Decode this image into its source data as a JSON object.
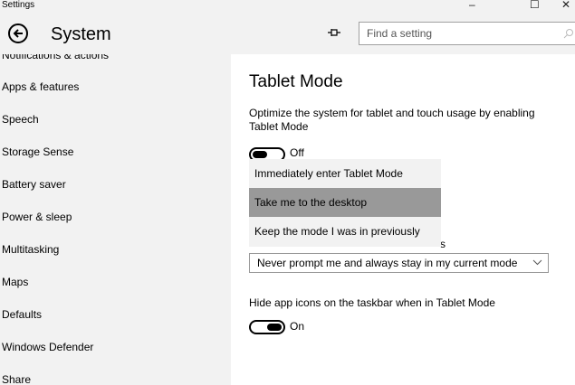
{
  "window": {
    "title": "Settings",
    "minimize": "–",
    "maximize": "☐",
    "close": "✕"
  },
  "header": {
    "title": "System",
    "search_placeholder": "Find a setting"
  },
  "sidebar": {
    "cut_item": "Notifications & actions",
    "items": [
      "Apps & features",
      "Speech",
      "Storage Sense",
      "Battery saver",
      "Power & sleep",
      "Multitasking",
      "Maps",
      "Defaults",
      "Windows Defender",
      "Share"
    ]
  },
  "content": {
    "title": "Tablet Mode",
    "description": "Optimize the system for tablet and touch usage by enabling Tablet Mode",
    "tablet_mode_toggle": {
      "state": "Off",
      "on": false
    },
    "signin_dropdown": {
      "options": [
        "Immediately enter Tablet Mode",
        "Take me to the desktop",
        "Keep the mode I was in previously"
      ],
      "highlighted_index": 1
    },
    "partial_label_tail": "s",
    "prompt_dropdown": {
      "value": "Never prompt me and always stay in my current mode"
    },
    "hide_icons": {
      "label": "Hide app icons on the taskbar when in Tablet Mode",
      "state": "On",
      "on": true
    }
  },
  "colors": {
    "sidebar_bg": "#f2f2f2",
    "highlight": "#999999",
    "text": "#000000"
  }
}
